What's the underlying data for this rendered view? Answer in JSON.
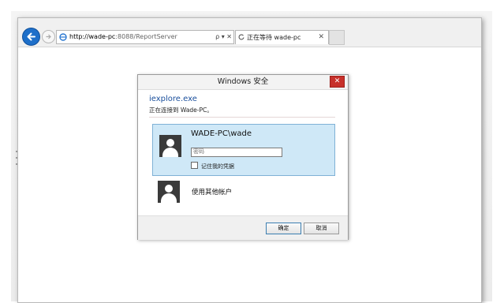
{
  "browser": {
    "address": {
      "host": "http://wade-pc",
      "rest": ":8088/ReportServer",
      "tools": "ρ ▾ ✕"
    },
    "tab": {
      "label": "正在等待 wade-pc",
      "close": "✕"
    }
  },
  "dialog": {
    "title": "Windows 安全",
    "close": "✕",
    "app_name": "iexplore.exe",
    "connecting_text": "正在连接到 Wade-PC。",
    "credential": {
      "user": "WADE-PC\\wade",
      "password_placeholder": "密码",
      "remember_label": "记住我的凭据"
    },
    "other_account_label": "使用其他帐户",
    "buttons": {
      "ok": "确定",
      "cancel": "取消"
    }
  },
  "colors": {
    "back_button": "#1e6fc9",
    "close_button": "#c7312b",
    "selected_tile": "#cfe8f7",
    "app_name": "#1a4f9c"
  }
}
